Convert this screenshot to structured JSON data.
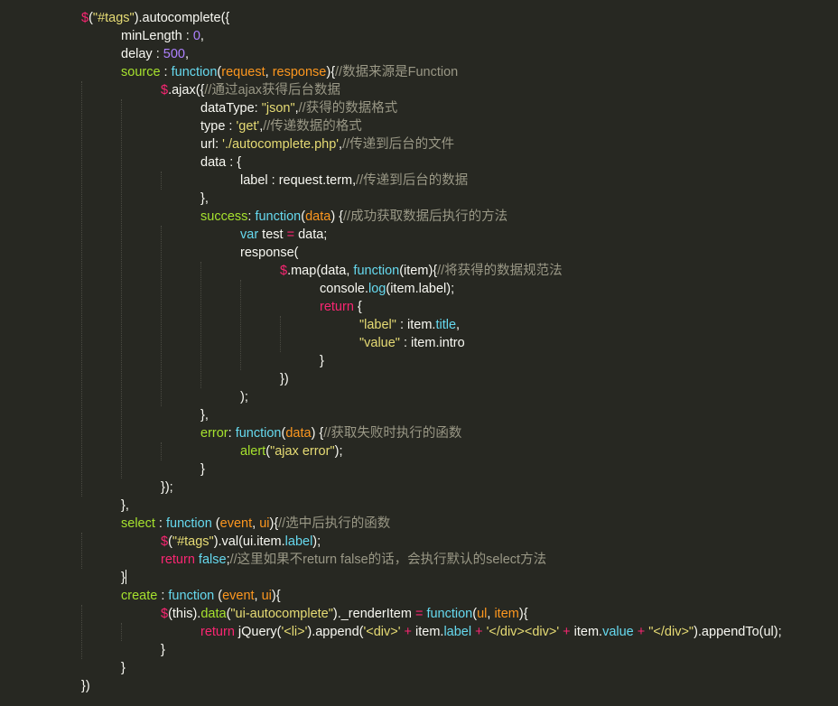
{
  "editor": {
    "language": "javascript",
    "theme_colors": {
      "background": "#272822",
      "plain": "#f8f8f2",
      "string": "#e6db74",
      "number": "#ae81ff",
      "key": "#a6e22e",
      "function": "#66d9ef",
      "param": "#fd971f",
      "keyword": "#f92672",
      "comment": "#9a9886"
    },
    "lines": [
      {
        "indent": 2,
        "tokens": [
          [
            "dollar",
            "$"
          ],
          [
            "plain",
            "("
          ],
          [
            "str",
            "\"#tags\""
          ],
          [
            "plain",
            ").autocomplete({"
          ]
        ]
      },
      {
        "indent": 3,
        "tokens": [
          [
            "plain",
            "minLength : "
          ],
          [
            "num",
            "0"
          ],
          [
            "plain",
            ","
          ]
        ]
      },
      {
        "indent": 3,
        "tokens": [
          [
            "plain",
            "delay : "
          ],
          [
            "num",
            "500"
          ],
          [
            "plain",
            ","
          ]
        ]
      },
      {
        "indent": 3,
        "tokens": [
          [
            "key",
            "source"
          ],
          [
            "plain",
            " : "
          ],
          [
            "func",
            "function"
          ],
          [
            "plain",
            "("
          ],
          [
            "param",
            "request"
          ],
          [
            "plain",
            ", "
          ],
          [
            "param",
            "response"
          ],
          [
            "plain",
            "){"
          ],
          [
            "comment",
            "//数据来源是Function"
          ]
        ]
      },
      {
        "indent": 4,
        "tokens": [
          [
            "dollar",
            "$"
          ],
          [
            "plain",
            ".ajax({"
          ],
          [
            "comment",
            "//通过ajax获得后台数据"
          ]
        ]
      },
      {
        "indent": 5,
        "tokens": [
          [
            "plain",
            "dataType: "
          ],
          [
            "str",
            "\"json\""
          ],
          [
            "plain",
            ","
          ],
          [
            "comment",
            "//获得的数据格式"
          ]
        ]
      },
      {
        "indent": 5,
        "tokens": [
          [
            "plain",
            "type : "
          ],
          [
            "str",
            "'get'"
          ],
          [
            "plain",
            ","
          ],
          [
            "comment",
            "//传递数据的格式"
          ]
        ]
      },
      {
        "indent": 5,
        "tokens": [
          [
            "plain",
            "url: "
          ],
          [
            "str",
            "'./autocomplete.php'"
          ],
          [
            "plain",
            ","
          ],
          [
            "comment",
            "//传递到后台的文件"
          ]
        ]
      },
      {
        "indent": 5,
        "tokens": [
          [
            "plain",
            "data : {"
          ]
        ]
      },
      {
        "indent": 6,
        "tokens": [
          [
            "plain",
            "label : request.term,"
          ],
          [
            "comment",
            "//传递到后台的数据"
          ]
        ]
      },
      {
        "indent": 5,
        "tokens": [
          [
            "plain",
            "},"
          ]
        ]
      },
      {
        "indent": 5,
        "tokens": [
          [
            "key",
            "success"
          ],
          [
            "plain",
            ": "
          ],
          [
            "func",
            "function"
          ],
          [
            "plain",
            "("
          ],
          [
            "param",
            "data"
          ],
          [
            "plain",
            ") {"
          ],
          [
            "comment",
            "//成功获取数据后执行的方法"
          ]
        ]
      },
      {
        "indent": 6,
        "tokens": [
          [
            "func",
            "var"
          ],
          [
            "plain",
            " test "
          ],
          [
            "kw",
            "="
          ],
          [
            "plain",
            " data;"
          ]
        ]
      },
      {
        "indent": 6,
        "tokens": [
          [
            "plain",
            "response("
          ]
        ]
      },
      {
        "indent": 7,
        "tokens": [
          [
            "dollar",
            "$"
          ],
          [
            "plain",
            ".map(data, "
          ],
          [
            "func",
            "function"
          ],
          [
            "plain",
            "(item){"
          ],
          [
            "comment",
            "//将获得的数据规范法"
          ]
        ]
      },
      {
        "indent": 8,
        "tokens": [
          [
            "plain",
            "console."
          ],
          [
            "prop",
            "log"
          ],
          [
            "plain",
            "(item.label);"
          ]
        ]
      },
      {
        "indent": 8,
        "tokens": [
          [
            "kw",
            "return"
          ],
          [
            "plain",
            " {"
          ]
        ]
      },
      {
        "indent": 9,
        "tokens": [
          [
            "str",
            "\"label\""
          ],
          [
            "plain",
            " : item."
          ],
          [
            "prop",
            "title"
          ],
          [
            "plain",
            ","
          ]
        ]
      },
      {
        "indent": 9,
        "tokens": [
          [
            "str",
            "\"value\""
          ],
          [
            "plain",
            " : item.intro"
          ]
        ]
      },
      {
        "indent": 8,
        "tokens": [
          [
            "plain",
            "}"
          ]
        ]
      },
      {
        "indent": 7,
        "tokens": [
          [
            "plain",
            "})"
          ]
        ]
      },
      {
        "indent": 6,
        "tokens": [
          [
            "plain",
            ");"
          ]
        ]
      },
      {
        "indent": 5,
        "tokens": [
          [
            "plain",
            "},"
          ]
        ]
      },
      {
        "indent": 5,
        "tokens": [
          [
            "key",
            "error"
          ],
          [
            "plain",
            ": "
          ],
          [
            "func",
            "function"
          ],
          [
            "plain",
            "("
          ],
          [
            "param",
            "data"
          ],
          [
            "plain",
            ") {"
          ],
          [
            "comment",
            "//获取失败时执行的函数"
          ]
        ]
      },
      {
        "indent": 6,
        "tokens": [
          [
            "key",
            "alert"
          ],
          [
            "plain",
            "("
          ],
          [
            "str",
            "\"ajax error\""
          ],
          [
            "plain",
            ");"
          ]
        ]
      },
      {
        "indent": 5,
        "tokens": [
          [
            "plain",
            "}"
          ]
        ]
      },
      {
        "indent": 4,
        "tokens": [
          [
            "plain",
            "});"
          ]
        ]
      },
      {
        "indent": 3,
        "tokens": [
          [
            "plain",
            "},"
          ]
        ]
      },
      {
        "indent": 3,
        "tokens": [
          [
            "key",
            "select"
          ],
          [
            "plain",
            " : "
          ],
          [
            "func",
            "function"
          ],
          [
            "plain",
            " ("
          ],
          [
            "param",
            "event"
          ],
          [
            "plain",
            ", "
          ],
          [
            "param",
            "ui"
          ],
          [
            "plain",
            "){"
          ],
          [
            "comment",
            "//选中后执行的函数"
          ]
        ]
      },
      {
        "indent": 4,
        "tokens": [
          [
            "dollar",
            "$"
          ],
          [
            "plain",
            "("
          ],
          [
            "str",
            "\"#tags\""
          ],
          [
            "plain",
            ").val(ui.item."
          ],
          [
            "prop",
            "label"
          ],
          [
            "plain",
            ");"
          ]
        ]
      },
      {
        "indent": 4,
        "tokens": [
          [
            "kw",
            "return"
          ],
          [
            "plain",
            " "
          ],
          [
            "func",
            "false"
          ],
          [
            "plain",
            ";"
          ],
          [
            "comment",
            "//这里如果不return false的话，会执行默认的select方法"
          ]
        ]
      },
      {
        "indent": 3,
        "cursor": true,
        "tokens": [
          [
            "plain",
            "}"
          ]
        ]
      },
      {
        "indent": 3,
        "tokens": [
          [
            "key",
            "create"
          ],
          [
            "plain",
            " : "
          ],
          [
            "func",
            "function"
          ],
          [
            "plain",
            " ("
          ],
          [
            "param",
            "event"
          ],
          [
            "plain",
            ", "
          ],
          [
            "param",
            "ui"
          ],
          [
            "plain",
            "){"
          ]
        ]
      },
      {
        "indent": 4,
        "tokens": [
          [
            "dollar",
            "$"
          ],
          [
            "plain",
            "(this)."
          ],
          [
            "key",
            "data"
          ],
          [
            "plain",
            "("
          ],
          [
            "str",
            "\"ui-autocomplete\""
          ],
          [
            "plain",
            ")._renderItem "
          ],
          [
            "kw",
            "="
          ],
          [
            "plain",
            " "
          ],
          [
            "func",
            "function"
          ],
          [
            "plain",
            "("
          ],
          [
            "param",
            "ul"
          ],
          [
            "plain",
            ", "
          ],
          [
            "param",
            "item"
          ],
          [
            "plain",
            "){"
          ]
        ]
      },
      {
        "indent": 5,
        "tokens": [
          [
            "kw",
            "return"
          ],
          [
            "plain",
            " jQuery("
          ],
          [
            "str",
            "'<li>'"
          ],
          [
            "plain",
            ").append("
          ],
          [
            "str",
            "'<div>'"
          ],
          [
            "plain",
            " "
          ],
          [
            "kw",
            "+"
          ],
          [
            "plain",
            " item."
          ],
          [
            "prop",
            "label"
          ],
          [
            "plain",
            " "
          ],
          [
            "kw",
            "+"
          ],
          [
            "plain",
            " "
          ],
          [
            "str",
            "'</div><div>'"
          ],
          [
            "plain",
            " "
          ],
          [
            "kw",
            "+"
          ],
          [
            "plain",
            " item."
          ],
          [
            "prop",
            "value"
          ],
          [
            "plain",
            " "
          ],
          [
            "kw",
            "+"
          ],
          [
            "plain",
            " "
          ],
          [
            "str",
            "\"</div>\""
          ],
          [
            "plain",
            ").appendTo(ul);"
          ]
        ]
      },
      {
        "indent": 4,
        "tokens": [
          [
            "plain",
            "}"
          ]
        ]
      },
      {
        "indent": 3,
        "tokens": [
          [
            "plain",
            "}"
          ]
        ]
      },
      {
        "indent": 2,
        "tokens": [
          [
            "plain",
            "})"
          ]
        ]
      }
    ]
  }
}
